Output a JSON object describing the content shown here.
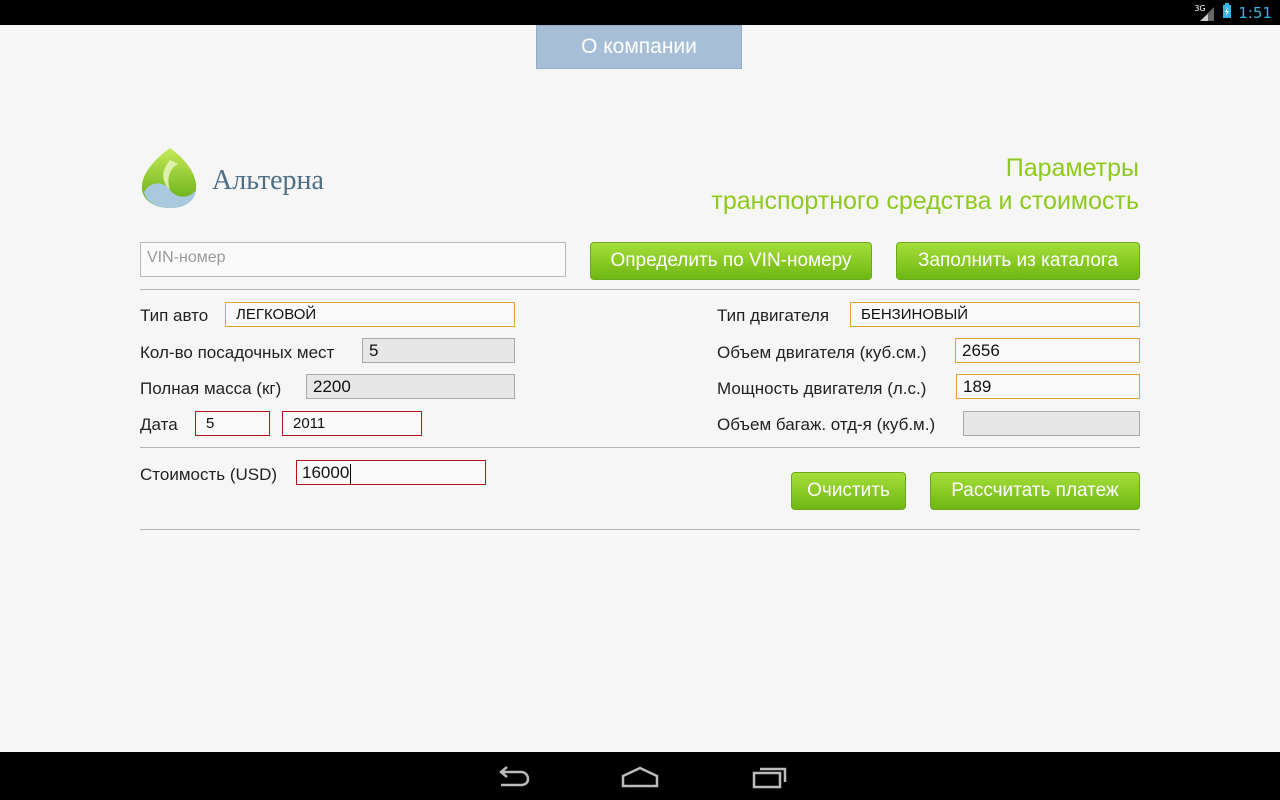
{
  "status": {
    "signal": "3G",
    "time": "1:51"
  },
  "header": {
    "about_button": "О компании"
  },
  "logo": {
    "text": "Альтерна"
  },
  "title": {
    "line1": "Параметры",
    "line2": "транспортного средства и стоимость"
  },
  "vin": {
    "placeholder": "VIN-номер",
    "detect_button": "Определить по VIN-номеру",
    "catalog_button": "Заполнить из каталога"
  },
  "left_fields": {
    "car_type": {
      "label": "Тип авто",
      "value": "ЛЕГКОВОЙ"
    },
    "seats": {
      "label": "Кол-во посадочных мест",
      "value": "5"
    },
    "mass": {
      "label": "Полная масса (кг)",
      "value": "2200"
    },
    "date": {
      "label": "Дата",
      "month": "5",
      "year": "2011"
    }
  },
  "right_fields": {
    "engine_type": {
      "label": "Тип двигателя",
      "value": "БЕНЗИНОВЫЙ"
    },
    "engine_volume": {
      "label": "Объем двигателя (куб.см.)",
      "value": "2656"
    },
    "engine_power": {
      "label": "Мощность двигателя (л.с.)",
      "value": "189"
    },
    "trunk_volume": {
      "label": "Объем багаж. отд-я (куб.м.)",
      "value": ""
    }
  },
  "cost": {
    "label": "Стоимость (USD)",
    "value": "16000"
  },
  "actions": {
    "clear_button": "Очистить",
    "calculate_button": "Рассчитать платеж"
  },
  "colors": {
    "accent_green": "#8ec91e",
    "button_green": "#7fc31c",
    "about_blue": "#a7bfd6",
    "error_red": "#b5121b",
    "warn_orange": "#e0a232"
  }
}
